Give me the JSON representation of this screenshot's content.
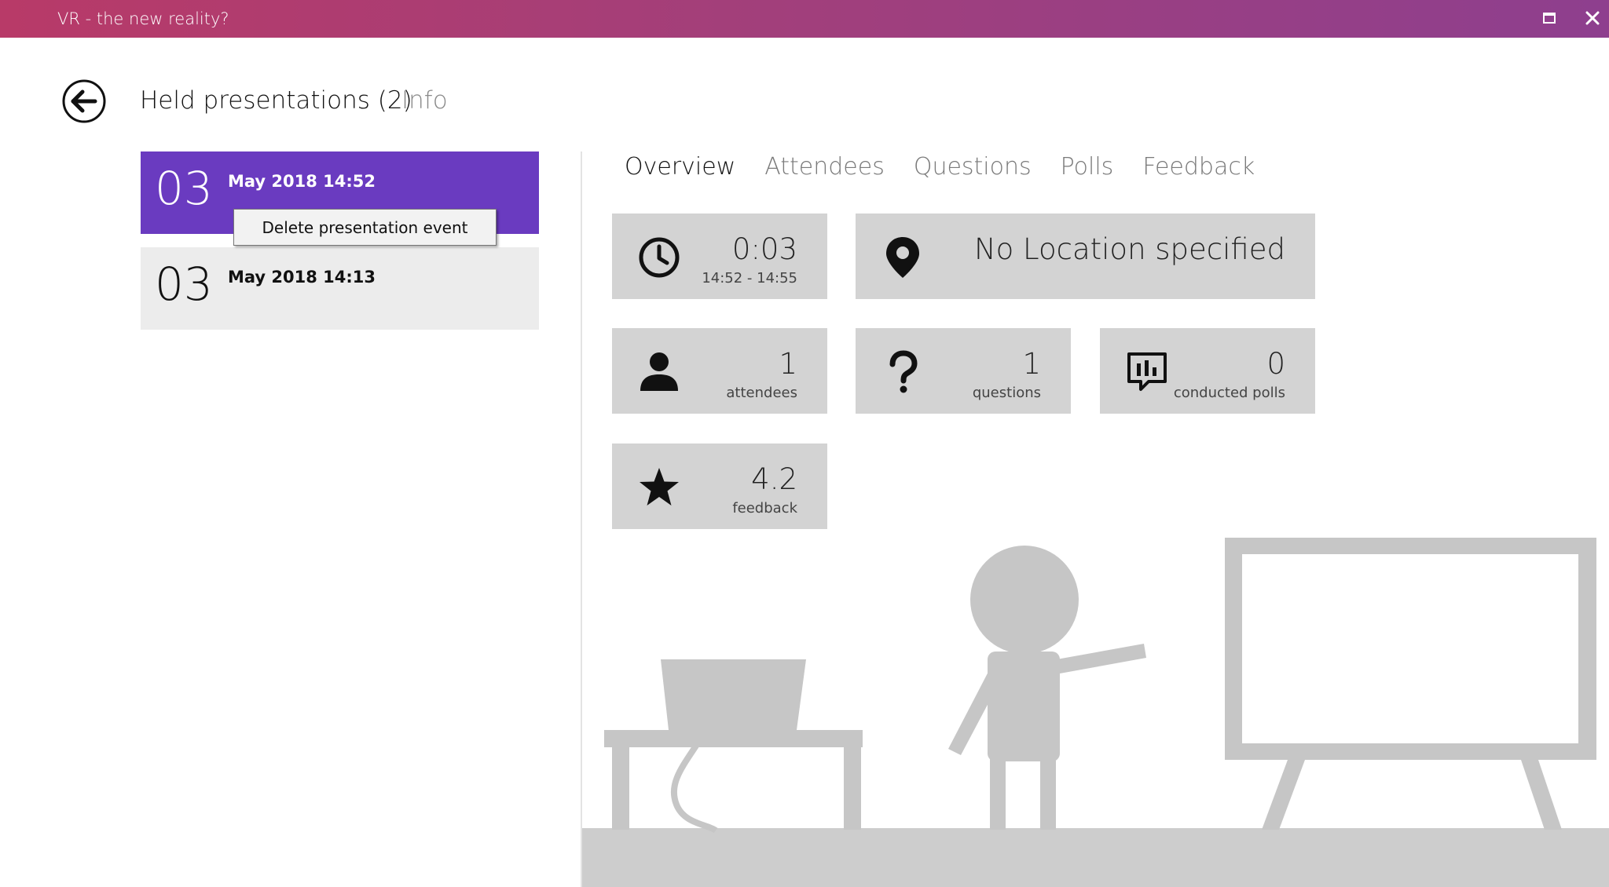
{
  "window": {
    "title": "VR - the new reality?",
    "maximize_icon": "maximize-icon",
    "close_icon": "close-icon"
  },
  "header": {
    "back_icon": "back-arrow-icon",
    "title": "Held presentations (2)",
    "info_label": "Info"
  },
  "presentations": [
    {
      "day": "03",
      "datetime": "May 2018 14:52",
      "selected": true
    },
    {
      "day": "03",
      "datetime": "May 2018 14:13",
      "selected": false
    }
  ],
  "context_menu": {
    "items": [
      "Delete presentation event"
    ]
  },
  "tabs": [
    {
      "label": "Overview",
      "active": true
    },
    {
      "label": "Attendees",
      "active": false
    },
    {
      "label": "Questions",
      "active": false
    },
    {
      "label": "Polls",
      "active": false
    },
    {
      "label": "Feedback",
      "active": false
    }
  ],
  "stats": {
    "duration": {
      "value": "0:03",
      "range": "14:52 - 14:55",
      "icon": "clock-icon"
    },
    "location": {
      "value": "No Location specified",
      "icon": "location-pin-icon"
    },
    "attendees": {
      "value": "1",
      "label": "attendees",
      "icon": "person-icon"
    },
    "questions": {
      "value": "1",
      "label": "questions",
      "icon": "question-mark-icon"
    },
    "polls": {
      "value": "0",
      "label": "conducted polls",
      "icon": "poll-icon"
    },
    "feedback": {
      "value": "4.2",
      "label": "feedback",
      "icon": "star-icon"
    }
  },
  "colors": {
    "accent": "#6a3bc0",
    "titlebar_start": "#b83a68",
    "titlebar_end": "#8e3f8e",
    "tile_bg": "#d3d3d3",
    "illustration": "#c9c9c9"
  }
}
